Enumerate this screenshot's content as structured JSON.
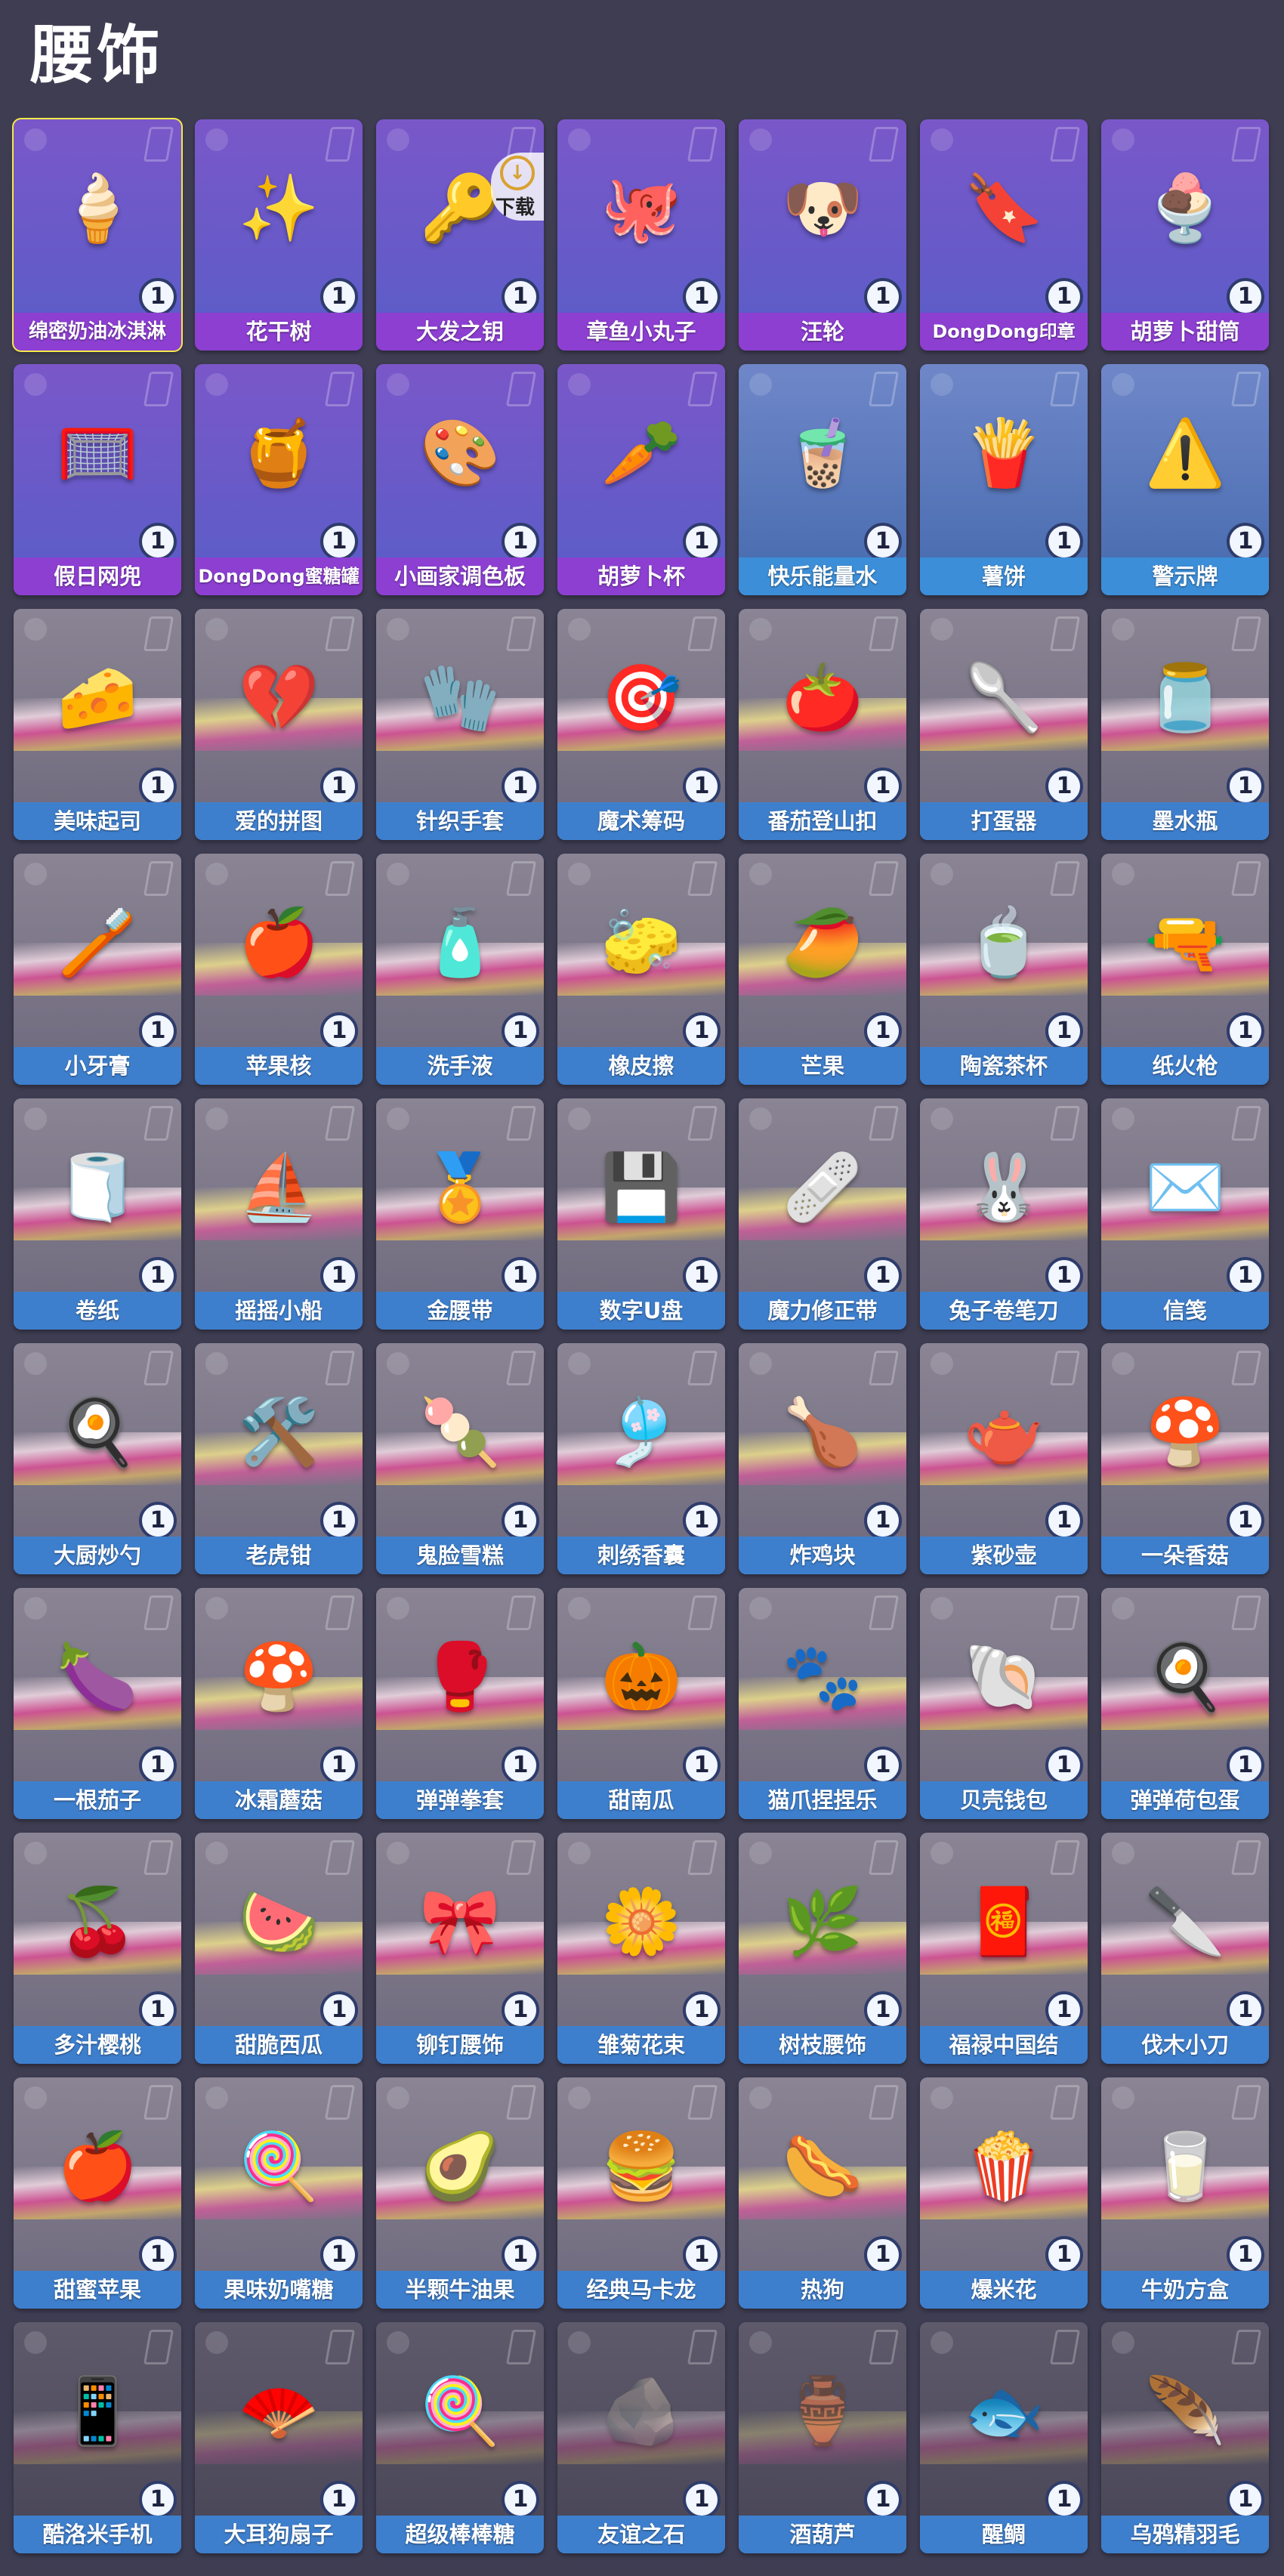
{
  "page": {
    "title": "腰饰",
    "download_label": "下载",
    "background": "#3f3d52"
  },
  "rarity_colors": {
    "purple": {
      "bar": "#8d3fd2",
      "bg_top": "#7a57c9",
      "bg_bottom": "#5e5cc8"
    },
    "blue": {
      "bar": "#3c8ed8",
      "bg_top": "#6f87c9",
      "bg_bottom": "#4c6fb2"
    },
    "grey": {
      "bar": "#3e7fcd",
      "bg_top": "#8a8494",
      "bg_bottom": "#726d80"
    },
    "dark": {
      "bar": "#3e7fcd",
      "bg_top": "#5e5a6b",
      "bg_bottom": "#4b4859"
    }
  },
  "items": [
    {
      "name": "绵密奶油冰淇淋",
      "qty": "1",
      "rarity": "purple",
      "icon": "ice-cream-cone",
      "glyph": "🍦",
      "selected": true
    },
    {
      "name": "花干树",
      "qty": "1",
      "rarity": "purple",
      "icon": "sparkle-tree",
      "glyph": "✨"
    },
    {
      "name": "大发之钥",
      "qty": "1",
      "rarity": "purple",
      "icon": "key",
      "glyph": "🔑",
      "download": true
    },
    {
      "name": "章鱼小丸子",
      "qty": "1",
      "rarity": "purple",
      "icon": "octopus-ball",
      "glyph": "🐙"
    },
    {
      "name": "汪轮",
      "qty": "1",
      "rarity": "purple",
      "icon": "dog-wheel",
      "glyph": "🐶"
    },
    {
      "name": "DongDong印章",
      "qty": "1",
      "rarity": "purple",
      "icon": "stamp",
      "glyph": "🔖"
    },
    {
      "name": "胡萝卜甜筒",
      "qty": "1",
      "rarity": "purple",
      "icon": "carrot-cone",
      "glyph": "🍨"
    },
    {
      "name": "假日网兜",
      "qty": "1",
      "rarity": "purple",
      "icon": "net",
      "glyph": "🥅"
    },
    {
      "name": "DongDong蜜糖罐",
      "qty": "1",
      "rarity": "purple",
      "icon": "honey-jar",
      "glyph": "🍯"
    },
    {
      "name": "小画家调色板",
      "qty": "1",
      "rarity": "purple",
      "icon": "palette",
      "glyph": "🎨"
    },
    {
      "name": "胡萝卜杯",
      "qty": "1",
      "rarity": "purple",
      "icon": "carrot-cup",
      "glyph": "🥕"
    },
    {
      "name": "快乐能量水",
      "qty": "1",
      "rarity": "blue",
      "icon": "bubble-tea",
      "glyph": "🧋"
    },
    {
      "name": "薯饼",
      "qty": "1",
      "rarity": "blue",
      "icon": "fries",
      "glyph": "🍟"
    },
    {
      "name": "警示牌",
      "qty": "1",
      "rarity": "blue",
      "icon": "warning-sign",
      "glyph": "⚠️"
    },
    {
      "name": "美味起司",
      "qty": "1",
      "rarity": "grey",
      "icon": "cheese",
      "glyph": "🧀"
    },
    {
      "name": "爱的拼图",
      "qty": "1",
      "rarity": "grey",
      "icon": "heart-puzzle",
      "glyph": "💔"
    },
    {
      "name": "针织手套",
      "qty": "1",
      "rarity": "grey",
      "icon": "mitten",
      "glyph": "🧤"
    },
    {
      "name": "魔术筹码",
      "qty": "1",
      "rarity": "grey",
      "icon": "poker-chip",
      "glyph": "🎯"
    },
    {
      "name": "番茄登山扣",
      "qty": "1",
      "rarity": "grey",
      "icon": "tomato-carabiner",
      "glyph": "🍅"
    },
    {
      "name": "打蛋器",
      "qty": "1",
      "rarity": "grey",
      "icon": "whisk",
      "glyph": "🥄"
    },
    {
      "name": "墨水瓶",
      "qty": "1",
      "rarity": "grey",
      "icon": "ink-bottle",
      "glyph": "🫙"
    },
    {
      "name": "小牙膏",
      "qty": "1",
      "rarity": "grey",
      "icon": "toothpaste",
      "glyph": "🪥"
    },
    {
      "name": "苹果核",
      "qty": "1",
      "rarity": "grey",
      "icon": "apple-core",
      "glyph": "🍎"
    },
    {
      "name": "洗手液",
      "qty": "1",
      "rarity": "grey",
      "icon": "hand-soap",
      "glyph": "🧴"
    },
    {
      "name": "橡皮擦",
      "qty": "1",
      "rarity": "grey",
      "icon": "eraser",
      "glyph": "🧽"
    },
    {
      "name": "芒果",
      "qty": "1",
      "rarity": "grey",
      "icon": "mango",
      "glyph": "🥭"
    },
    {
      "name": "陶瓷茶杯",
      "qty": "1",
      "rarity": "grey",
      "icon": "tea-cup",
      "glyph": "🍵"
    },
    {
      "name": "纸火枪",
      "qty": "1",
      "rarity": "grey",
      "icon": "paper-gun",
      "glyph": "🔫"
    },
    {
      "name": "卷纸",
      "qty": "1",
      "rarity": "grey",
      "icon": "toilet-roll",
      "glyph": "🧻"
    },
    {
      "name": "摇摇小船",
      "qty": "1",
      "rarity": "grey",
      "icon": "paper-boat",
      "glyph": "⛵"
    },
    {
      "name": "金腰带",
      "qty": "1",
      "rarity": "grey",
      "icon": "gold-belt",
      "glyph": "🏅"
    },
    {
      "name": "数字U盘",
      "qty": "1",
      "rarity": "grey",
      "icon": "usb-drive",
      "glyph": "💾"
    },
    {
      "name": "魔力修正带",
      "qty": "1",
      "rarity": "grey",
      "icon": "correction-tape",
      "glyph": "🩹"
    },
    {
      "name": "兔子卷笔刀",
      "qty": "1",
      "rarity": "grey",
      "icon": "rabbit-sharpener",
      "glyph": "🐰"
    },
    {
      "name": "信笺",
      "qty": "1",
      "rarity": "grey",
      "icon": "envelope",
      "glyph": "✉️"
    },
    {
      "name": "大厨炒勺",
      "qty": "1",
      "rarity": "grey",
      "icon": "ladle",
      "glyph": "🍳"
    },
    {
      "name": "老虎钳",
      "qty": "1",
      "rarity": "grey",
      "icon": "pliers",
      "glyph": "🛠️"
    },
    {
      "name": "鬼脸雪糕",
      "qty": "1",
      "rarity": "grey",
      "icon": "popsicle",
      "glyph": "🍡"
    },
    {
      "name": "刺绣香囊",
      "qty": "1",
      "rarity": "grey",
      "icon": "sachet",
      "glyph": "🎐"
    },
    {
      "name": "炸鸡块",
      "qty": "1",
      "rarity": "grey",
      "icon": "nugget",
      "glyph": "🍗"
    },
    {
      "name": "紫砂壶",
      "qty": "1",
      "rarity": "grey",
      "icon": "teapot",
      "glyph": "🫖"
    },
    {
      "name": "一朵香菇",
      "qty": "1",
      "rarity": "grey",
      "icon": "mushroom",
      "glyph": "🍄"
    },
    {
      "name": "一根茄子",
      "qty": "1",
      "rarity": "grey",
      "icon": "eggplant",
      "glyph": "🍆"
    },
    {
      "name": "冰霜蘑菇",
      "qty": "1",
      "rarity": "grey",
      "icon": "frost-mushroom",
      "glyph": "🍄"
    },
    {
      "name": "弹弹拳套",
      "qty": "1",
      "rarity": "grey",
      "icon": "spring-glove",
      "glyph": "🥊"
    },
    {
      "name": "甜南瓜",
      "qty": "1",
      "rarity": "grey",
      "icon": "pumpkin",
      "glyph": "🎃"
    },
    {
      "name": "猫爪捏捏乐",
      "qty": "1",
      "rarity": "grey",
      "icon": "cat-paw",
      "glyph": "🐾"
    },
    {
      "name": "贝壳钱包",
      "qty": "1",
      "rarity": "grey",
      "icon": "shell-purse",
      "glyph": "🐚"
    },
    {
      "name": "弹弹荷包蛋",
      "qty": "1",
      "rarity": "grey",
      "icon": "fried-egg",
      "glyph": "🍳"
    },
    {
      "name": "多汁樱桃",
      "qty": "1",
      "rarity": "grey",
      "icon": "cherries",
      "glyph": "🍒"
    },
    {
      "name": "甜脆西瓜",
      "qty": "1",
      "rarity": "grey",
      "icon": "watermelon",
      "glyph": "🍉"
    },
    {
      "name": "铆钉腰饰",
      "qty": "1",
      "rarity": "grey",
      "icon": "bow-tie",
      "glyph": "🎀"
    },
    {
      "name": "雏菊花束",
      "qty": "1",
      "rarity": "grey",
      "icon": "daisy",
      "glyph": "🌼"
    },
    {
      "name": "树枝腰饰",
      "qty": "1",
      "rarity": "grey",
      "icon": "branch",
      "glyph": "🌿"
    },
    {
      "name": "福禄中国结",
      "qty": "1",
      "rarity": "grey",
      "icon": "chinese-knot",
      "glyph": "🧧"
    },
    {
      "name": "伐木小刀",
      "qty": "1",
      "rarity": "grey",
      "icon": "knife",
      "glyph": "🔪"
    },
    {
      "name": "甜蜜苹果",
      "qty": "1",
      "rarity": "grey",
      "icon": "apple",
      "glyph": "🍎"
    },
    {
      "name": "果味奶嘴糖",
      "qty": "1",
      "rarity": "grey",
      "icon": "pacifier-candy",
      "glyph": "🍭"
    },
    {
      "name": "半颗牛油果",
      "qty": "1",
      "rarity": "grey",
      "icon": "avocado",
      "glyph": "🥑"
    },
    {
      "name": "经典马卡龙",
      "qty": "1",
      "rarity": "grey",
      "icon": "macaron",
      "glyph": "🍔"
    },
    {
      "name": "热狗",
      "qty": "1",
      "rarity": "grey",
      "icon": "hot-dog",
      "glyph": "🌭"
    },
    {
      "name": "爆米花",
      "qty": "1",
      "rarity": "grey",
      "icon": "popcorn",
      "glyph": "🍿"
    },
    {
      "name": "牛奶方盒",
      "qty": "1",
      "rarity": "grey",
      "icon": "milk-carton",
      "glyph": "🥛"
    },
    {
      "name": "酷洛米手机",
      "qty": "1",
      "rarity": "dark",
      "icon": "phone",
      "glyph": "📱"
    },
    {
      "name": "大耳狗扇子",
      "qty": "1",
      "rarity": "dark",
      "icon": "fan",
      "glyph": "🪭"
    },
    {
      "name": "超级棒棒糖",
      "qty": "1",
      "rarity": "dark",
      "icon": "lollipop",
      "glyph": "🍭"
    },
    {
      "name": "友谊之石",
      "qty": "1",
      "rarity": "dark",
      "icon": "stone",
      "glyph": "🪨",
      "dim": true
    },
    {
      "name": "酒葫芦",
      "qty": "1",
      "rarity": "dark",
      "icon": "gourd",
      "glyph": "🏺",
      "dim": true
    },
    {
      "name": "醒鲷",
      "qty": "1",
      "rarity": "dark",
      "icon": "fish",
      "glyph": "🐟"
    },
    {
      "name": "乌鸦精羽毛",
      "qty": "1",
      "rarity": "dark",
      "icon": "feather",
      "glyph": "🪶"
    }
  ]
}
